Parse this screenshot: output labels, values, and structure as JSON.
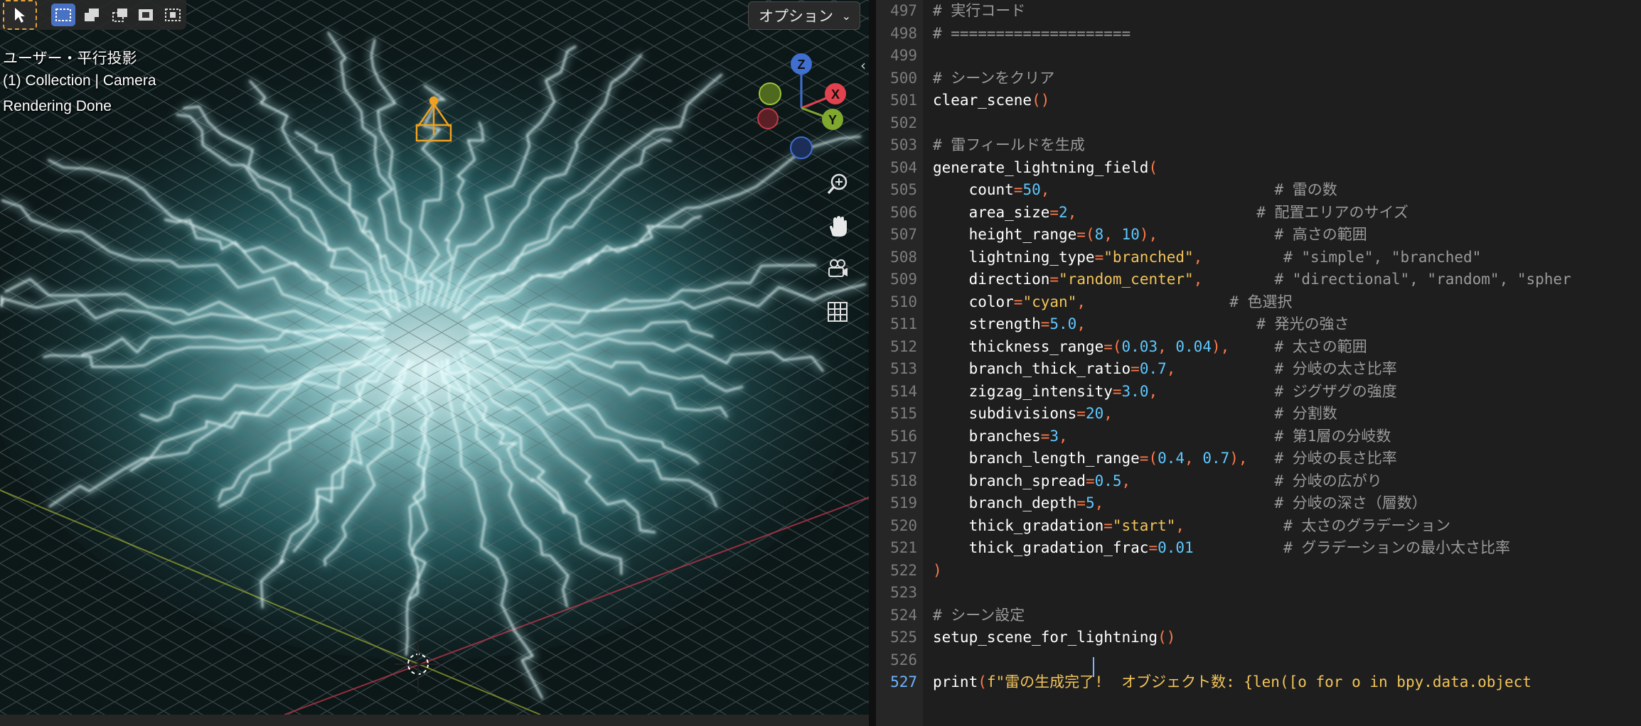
{
  "toolbar": {
    "select_tool_icon": "cursor-arrow-icon",
    "mode_icons": [
      "box-select-new-icon",
      "box-select-extend-icon",
      "box-select-subtract-icon",
      "box-select-invert-icon",
      "box-select-intersect-icon"
    ]
  },
  "options_dropdown": {
    "label": "オプション",
    "chevron": "chevron-down-icon"
  },
  "hud": {
    "view": "ユーザー・平行投影",
    "collection": "(1) Collection | Camera",
    "status": "Rendering Done"
  },
  "gizmo": {
    "axes": [
      "Z",
      "X",
      "Y"
    ],
    "colors": {
      "x": "#e2424e",
      "y": "#7fa82e",
      "z": "#3f6fd0"
    }
  },
  "nav_buttons": [
    "zoom-icon",
    "hand-pan-icon",
    "camera-view-icon",
    "grid-ortho-icon"
  ],
  "editor": {
    "lines": [
      {
        "n": "497",
        "t": [
          [
            "cm",
            "# 実行コード"
          ]
        ]
      },
      {
        "n": "498",
        "t": [
          [
            "cm",
            "# ===================="
          ]
        ]
      },
      {
        "n": "499",
        "t": []
      },
      {
        "n": "500",
        "t": [
          [
            "cm",
            "# シーンをクリア"
          ]
        ]
      },
      {
        "n": "501",
        "t": [
          [
            "tx",
            "clear_scene"
          ],
          [
            "pu",
            "()"
          ]
        ]
      },
      {
        "n": "502",
        "t": []
      },
      {
        "n": "503",
        "t": [
          [
            "cm",
            "# 雷フィールドを生成"
          ]
        ]
      },
      {
        "n": "504",
        "t": [
          [
            "tx",
            "generate_lightning_field"
          ],
          [
            "pu",
            "("
          ]
        ]
      },
      {
        "n": "505",
        "t": [
          [
            "tx",
            "    count"
          ],
          [
            "pu",
            "="
          ],
          [
            "nm",
            "50"
          ],
          [
            "pu",
            ","
          ],
          [
            "tx",
            "                         "
          ],
          [
            "cm",
            "# 雷の数"
          ]
        ]
      },
      {
        "n": "506",
        "t": [
          [
            "tx",
            "    area_size"
          ],
          [
            "pu",
            "="
          ],
          [
            "nm",
            "2"
          ],
          [
            "pu",
            ","
          ],
          [
            "tx",
            "                    "
          ],
          [
            "cm",
            "# 配置エリアのサイズ"
          ]
        ]
      },
      {
        "n": "507",
        "t": [
          [
            "tx",
            "    height_range"
          ],
          [
            "pu",
            "=("
          ],
          [
            "nm",
            "8"
          ],
          [
            "pu",
            ", "
          ],
          [
            "nm",
            "10"
          ],
          [
            "pu",
            "),"
          ],
          [
            "tx",
            "             "
          ],
          [
            "cm",
            "# 高さの範囲"
          ]
        ]
      },
      {
        "n": "508",
        "t": [
          [
            "tx",
            "    lightning_type"
          ],
          [
            "pu",
            "="
          ],
          [
            "st",
            "\"branched\""
          ],
          [
            "pu",
            ","
          ],
          [
            "tx",
            "         "
          ],
          [
            "cm",
            "# \"simple\", \"branched\""
          ]
        ]
      },
      {
        "n": "509",
        "t": [
          [
            "tx",
            "    direction"
          ],
          [
            "pu",
            "="
          ],
          [
            "st",
            "\"random_center\""
          ],
          [
            "pu",
            ","
          ],
          [
            "tx",
            "        "
          ],
          [
            "cm",
            "# \"directional\", \"random\", \"spher"
          ]
        ]
      },
      {
        "n": "510",
        "t": [
          [
            "tx",
            "    color"
          ],
          [
            "pu",
            "="
          ],
          [
            "st",
            "\"cyan\""
          ],
          [
            "pu",
            ","
          ],
          [
            "tx",
            "                "
          ],
          [
            "cm",
            "# 色選択"
          ]
        ]
      },
      {
        "n": "511",
        "t": [
          [
            "tx",
            "    strength"
          ],
          [
            "pu",
            "="
          ],
          [
            "nm",
            "5.0"
          ],
          [
            "pu",
            ","
          ],
          [
            "tx",
            "                   "
          ],
          [
            "cm",
            "# 発光の強さ"
          ]
        ]
      },
      {
        "n": "512",
        "t": [
          [
            "tx",
            "    thickness_range"
          ],
          [
            "pu",
            "=("
          ],
          [
            "nm",
            "0.03"
          ],
          [
            "pu",
            ", "
          ],
          [
            "nm",
            "0.04"
          ],
          [
            "pu",
            "),"
          ],
          [
            "tx",
            "     "
          ],
          [
            "cm",
            "# 太さの範囲"
          ]
        ]
      },
      {
        "n": "513",
        "t": [
          [
            "tx",
            "    branch_thick_ratio"
          ],
          [
            "pu",
            "="
          ],
          [
            "nm",
            "0.7"
          ],
          [
            "pu",
            ","
          ],
          [
            "tx",
            "           "
          ],
          [
            "cm",
            "# 分岐の太さ比率"
          ]
        ]
      },
      {
        "n": "514",
        "t": [
          [
            "tx",
            "    zigzag_intensity"
          ],
          [
            "pu",
            "="
          ],
          [
            "nm",
            "3.0"
          ],
          [
            "pu",
            ","
          ],
          [
            "tx",
            "             "
          ],
          [
            "cm",
            "# ジグザグの強度"
          ]
        ]
      },
      {
        "n": "515",
        "t": [
          [
            "tx",
            "    subdivisions"
          ],
          [
            "pu",
            "="
          ],
          [
            "nm",
            "20"
          ],
          [
            "pu",
            ","
          ],
          [
            "tx",
            "                  "
          ],
          [
            "cm",
            "# 分割数"
          ]
        ]
      },
      {
        "n": "516",
        "t": [
          [
            "tx",
            "    branches"
          ],
          [
            "pu",
            "="
          ],
          [
            "nm",
            "3"
          ],
          [
            "pu",
            ","
          ],
          [
            "tx",
            "                       "
          ],
          [
            "cm",
            "# 第1層の分岐数"
          ]
        ]
      },
      {
        "n": "517",
        "t": [
          [
            "tx",
            "    branch_length_range"
          ],
          [
            "pu",
            "=("
          ],
          [
            "nm",
            "0.4"
          ],
          [
            "pu",
            ", "
          ],
          [
            "nm",
            "0.7"
          ],
          [
            "pu",
            "),"
          ],
          [
            "tx",
            "   "
          ],
          [
            "cm",
            "# 分岐の長さ比率"
          ]
        ]
      },
      {
        "n": "518",
        "t": [
          [
            "tx",
            "    branch_spread"
          ],
          [
            "pu",
            "="
          ],
          [
            "nm",
            "0.5"
          ],
          [
            "pu",
            ","
          ],
          [
            "tx",
            "                "
          ],
          [
            "cm",
            "# 分岐の広がり"
          ]
        ]
      },
      {
        "n": "519",
        "t": [
          [
            "tx",
            "    branch_depth"
          ],
          [
            "pu",
            "="
          ],
          [
            "nm",
            "5"
          ],
          [
            "pu",
            ","
          ],
          [
            "tx",
            "                   "
          ],
          [
            "cm",
            "# 分岐の深さ（層数）"
          ]
        ]
      },
      {
        "n": "520",
        "t": [
          [
            "tx",
            "    thick_gradation"
          ],
          [
            "pu",
            "="
          ],
          [
            "st",
            "\"start\""
          ],
          [
            "pu",
            ","
          ],
          [
            "tx",
            "           "
          ],
          [
            "cm",
            "# 太さのグラデーション"
          ]
        ]
      },
      {
        "n": "521",
        "t": [
          [
            "tx",
            "    thick_gradation_frac"
          ],
          [
            "pu",
            "="
          ],
          [
            "nm",
            "0.01"
          ],
          [
            "tx",
            "          "
          ],
          [
            "cm",
            "# グラデーションの最小太さ比率"
          ]
        ]
      },
      {
        "n": "522",
        "t": [
          [
            "pu",
            ")"
          ]
        ]
      },
      {
        "n": "523",
        "t": []
      },
      {
        "n": "524",
        "t": [
          [
            "cm",
            "# シーン設定"
          ]
        ]
      },
      {
        "n": "525",
        "t": [
          [
            "tx",
            "setup_scene_for_lightning"
          ],
          [
            "pu",
            "()"
          ]
        ]
      },
      {
        "n": "526",
        "t": []
      },
      {
        "n": "527",
        "t": [
          [
            "tx",
            "print"
          ],
          [
            "pu",
            "("
          ],
          [
            "st",
            "f\"雷の生成完了!  オブジェクト数: {len([o for o in bpy.data.object"
          ]
        ]
      }
    ],
    "current_line": "527"
  }
}
